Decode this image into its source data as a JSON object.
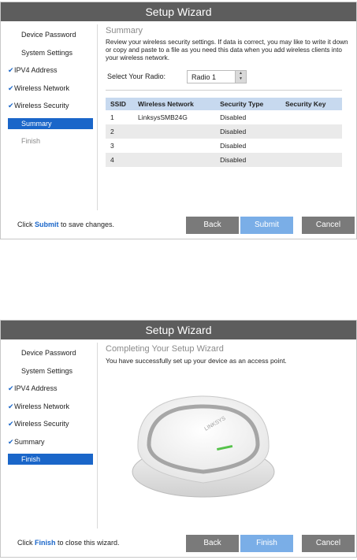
{
  "panel1": {
    "title": "Setup Wizard",
    "sidebar": [
      {
        "label": "Device Password",
        "checked": false,
        "state": "normal"
      },
      {
        "label": "System Settings",
        "checked": false,
        "state": "normal"
      },
      {
        "label": "IPV4 Address",
        "checked": true,
        "state": "normal"
      },
      {
        "label": "Wireless Network",
        "checked": true,
        "state": "normal"
      },
      {
        "label": "Wireless Security",
        "checked": true,
        "state": "normal"
      },
      {
        "label": "Summary",
        "checked": false,
        "state": "active"
      },
      {
        "label": "Finish",
        "checked": false,
        "state": "muted"
      }
    ],
    "section_title": "Summary",
    "description": "Review your wireless security settings. If data is correct, you may like to write it down or copy and paste to a file as you need this data when you add wireless clients into your wireless network.",
    "radio_label": "Select Your Radio:",
    "radio_value": "Radio 1",
    "table": {
      "headers": [
        "SSID",
        "Wireless Network",
        "Security Type",
        "Security Key"
      ],
      "rows": [
        [
          "1",
          "LinksysSMB24G",
          "Disabled",
          ""
        ],
        [
          "2",
          "",
          "Disabled",
          ""
        ],
        [
          "3",
          "",
          "Disabled",
          ""
        ],
        [
          "4",
          "",
          "Disabled",
          ""
        ]
      ]
    },
    "footer_prefix": "Click ",
    "footer_link": "Submit",
    "footer_suffix": " to save changes.",
    "buttons": {
      "back": "Back",
      "primary": "Submit",
      "cancel": "Cancel"
    }
  },
  "panel2": {
    "title": "Setup Wizard",
    "sidebar": [
      {
        "label": "Device Password",
        "checked": false,
        "state": "normal"
      },
      {
        "label": "System Settings",
        "checked": false,
        "state": "normal"
      },
      {
        "label": "IPV4 Address",
        "checked": true,
        "state": "normal"
      },
      {
        "label": "Wireless Network",
        "checked": true,
        "state": "normal"
      },
      {
        "label": "Wireless Security",
        "checked": true,
        "state": "normal"
      },
      {
        "label": "Summary",
        "checked": true,
        "state": "normal"
      },
      {
        "label": "Finish",
        "checked": false,
        "state": "active"
      }
    ],
    "section_title": "Completing Your Setup Wizard",
    "message": "You have successfully set up your device as an access point.",
    "device_brand": "LINKSYS",
    "footer_prefix": "Click ",
    "footer_link": "Finish",
    "footer_suffix": " to close this wizard.",
    "buttons": {
      "back": "Back",
      "primary": "Finish",
      "cancel": "Cancel"
    }
  },
  "colors": {
    "title_bar": "#5d5d5d",
    "accent": "#1a66c9",
    "table_header": "#c7d9ef",
    "primary_button": "#7aaee7",
    "button": "#7a7a7a"
  },
  "icons": {
    "check": "check-icon",
    "spinner": "spinner-arrows-icon"
  }
}
